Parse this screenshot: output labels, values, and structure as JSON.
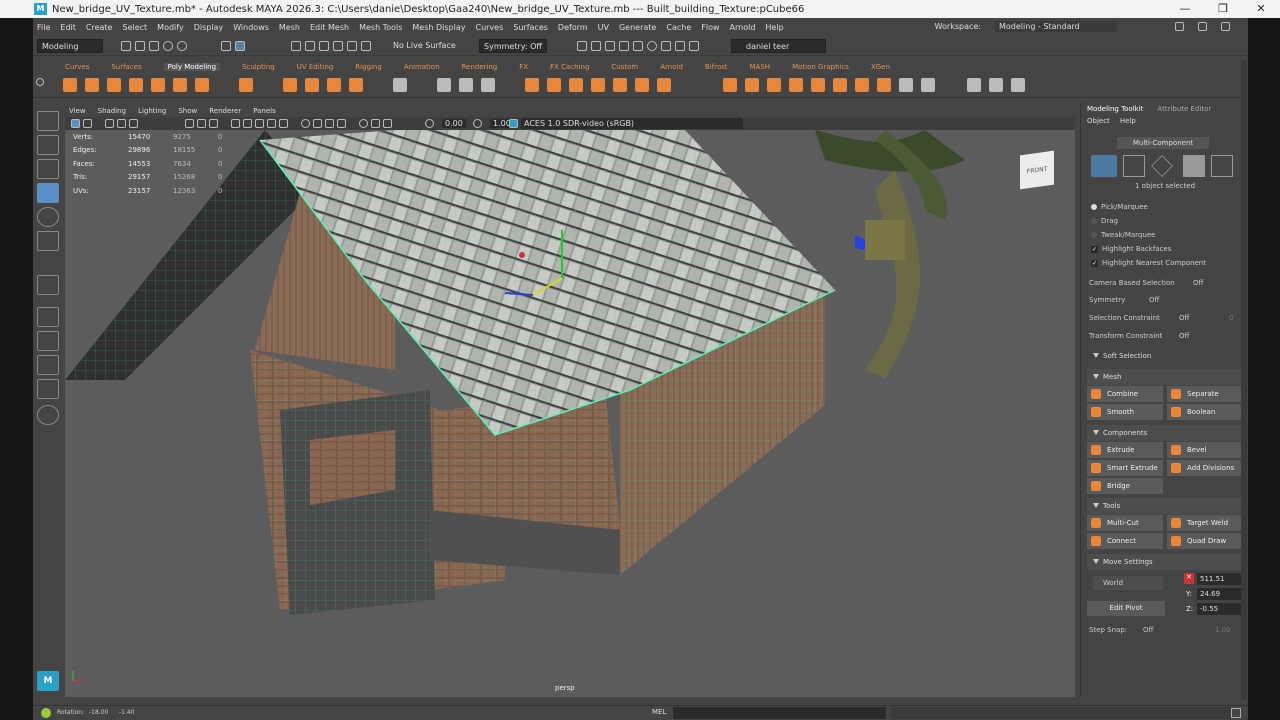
{
  "window": {
    "title": "New_bridge_UV_Texture.mb* - Autodesk MAYA 2026.3: C:\\Users\\danie\\Desktop\\Gaa240\\New_bridge_UV_Texture.mb   ---   Built_building_Texture:pCube66",
    "minimize": "—",
    "maximize": "❐",
    "close": "✕"
  },
  "menus": [
    "File",
    "Edit",
    "Create",
    "Select",
    "Modify",
    "Display",
    "Windows",
    "Mesh",
    "Edit Mesh",
    "Mesh Tools",
    "Mesh Display",
    "Curves",
    "Surfaces",
    "Deform",
    "UV",
    "Generate",
    "Cache",
    "Flow",
    "Arnold",
    "Help"
  ],
  "workspace": {
    "label": "Workspace:",
    "value": "Modeling - Standard"
  },
  "statusline": {
    "mode": "Modeling",
    "live": "No Live Surface",
    "symmetry": "Symmetry: Off",
    "user": "daniel teer"
  },
  "shelf_tabs": [
    "Curves",
    "Surfaces",
    "Poly Modeling",
    "Sculpting",
    "UV Editing",
    "Rigging",
    "Animation",
    "Rendering",
    "FX",
    "FX Caching",
    "Custom",
    "Arnold",
    "Bifrost",
    "MASH",
    "Motion Graphics",
    "XGen"
  ],
  "shelf_active": "Poly Modeling",
  "panel_menu": [
    "View",
    "Shading",
    "Lighting",
    "Show",
    "Renderer",
    "Panels"
  ],
  "panel_toolbar": {
    "value1": "0.00",
    "value2": "1.00",
    "colorspace": "ACES 1.0 SDR-video (sRGB)"
  },
  "hud": [
    {
      "label": "Verts:",
      "v1": "15470",
      "v2": "9275",
      "v3": "0"
    },
    {
      "label": "Edges:",
      "v1": "29896",
      "v2": "18155",
      "v3": "0"
    },
    {
      "label": "Faces:",
      "v1": "14553",
      "v2": "7634",
      "v3": "0"
    },
    {
      "label": "Tris:",
      "v1": "29157",
      "v2": "15268",
      "v3": "0"
    },
    {
      "label": "UVs:",
      "v1": "23157",
      "v2": "12363",
      "v3": "0"
    }
  ],
  "viewport": {
    "camera": "persp",
    "cube": "FRONT"
  },
  "toolkit": {
    "tabs": [
      "Modeling Toolkit",
      "Attribute Editor"
    ],
    "menu": [
      "Object",
      "Help"
    ],
    "mode": "Multi-Component",
    "selected": "1 object selected",
    "options": [
      "Pick/Marquee",
      "Drag",
      "Tweak/Marquee"
    ],
    "checks": [
      "Highlight Backfaces",
      "Highlight Nearest Component"
    ],
    "camera_based": {
      "label": "Camera Based Selection",
      "value": "Off"
    },
    "symmetry": {
      "label": "Symmetry",
      "value": "Off"
    },
    "sel_constraint": {
      "label": "Selection Constraint",
      "value": "Off",
      "num": "0"
    },
    "transform_constraint": {
      "label": "Transform Constraint",
      "value": "Off"
    },
    "soft": "Soft Selection",
    "mesh_header": "Mesh",
    "mesh": [
      "Combine",
      "Separate",
      "Smooth",
      "Boolean"
    ],
    "components_header": "Components",
    "components": [
      "Extrude",
      "Bevel",
      "Smart Extrude",
      "Add Divisions",
      "Bridge"
    ],
    "tools_header": "Tools",
    "tools": [
      "Multi-Cut",
      "Target Weld",
      "Connect",
      "Quad Draw"
    ],
    "move_header": "Move Settings",
    "world": "World",
    "edit_pivot": "Edit Pivot",
    "x_label": "X:",
    "x": "511.51",
    "y_label": "Y:",
    "y": "24.69",
    "z_label": "Z:",
    "z": "-0.55",
    "step_snap": {
      "label": "Step Snap:",
      "value": "Off",
      "num": "1.00"
    }
  },
  "bottom": {
    "rotation_label": "Rotation:",
    "rx": "-18.00",
    "ry": "-1.40",
    "mel": "MEL"
  }
}
